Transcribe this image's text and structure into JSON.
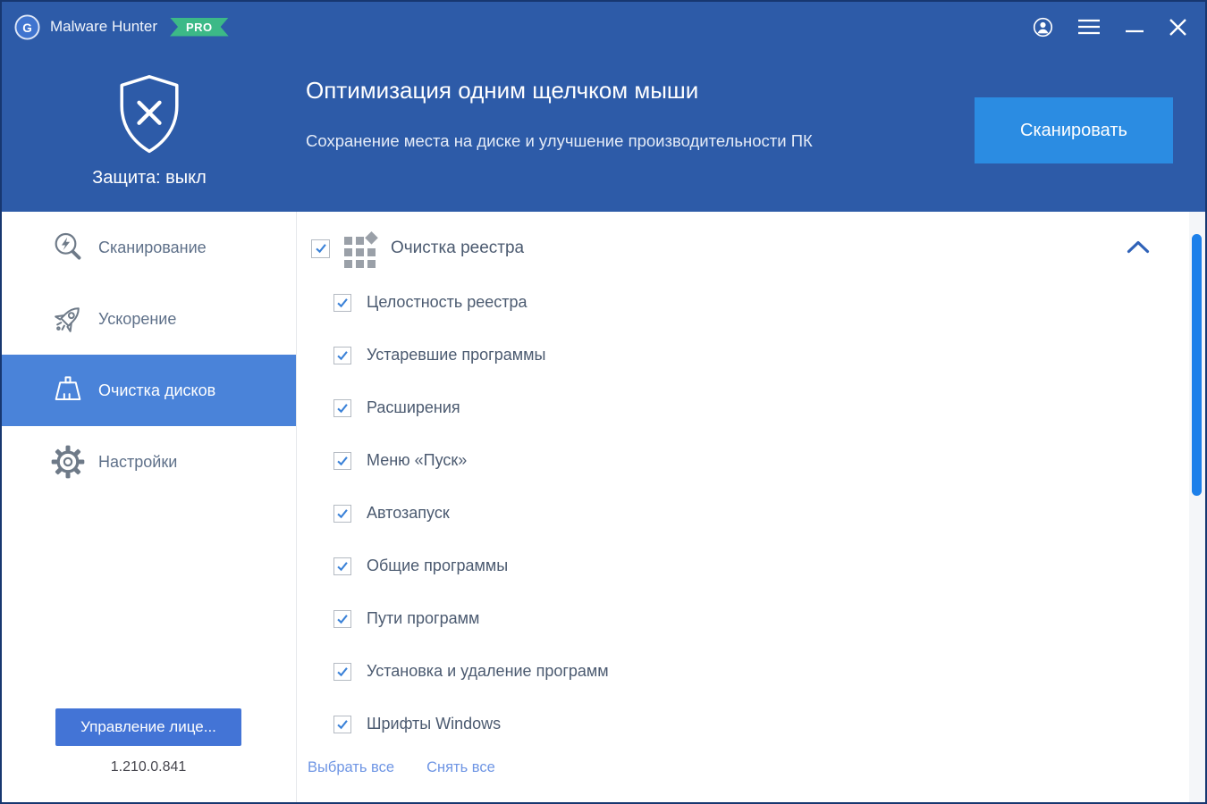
{
  "titlebar": {
    "app_name": "Malware Hunter",
    "badge": "PRO"
  },
  "header": {
    "protection_status": "Защита: выкл",
    "title": "Оптимизация одним щелчком мыши",
    "subtitle": "Сохранение места на диске и улучшение производительности ПК",
    "scan_button": "Сканировать"
  },
  "sidebar": {
    "items": [
      {
        "label": "Сканирование",
        "icon": "magnifier-lightning-icon",
        "selected": false
      },
      {
        "label": "Ускорение",
        "icon": "rocket-icon",
        "selected": false
      },
      {
        "label": "Очистка дисков",
        "icon": "broom-icon",
        "selected": true
      },
      {
        "label": "Настройки",
        "icon": "gear-icon",
        "selected": false
      }
    ],
    "license_button": "Управление лице...",
    "version": "1.210.0.841"
  },
  "main": {
    "group": {
      "label": "Очистка реестра",
      "checked": true,
      "expanded": true
    },
    "items": [
      {
        "label": "Целостность реестра",
        "checked": true
      },
      {
        "label": "Устаревшие программы",
        "checked": true
      },
      {
        "label": "Расширения",
        "checked": true
      },
      {
        "label": "Меню «Пуск»",
        "checked": true
      },
      {
        "label": "Автозапуск",
        "checked": true
      },
      {
        "label": "Общие программы",
        "checked": true
      },
      {
        "label": "Пути программ",
        "checked": true
      },
      {
        "label": "Установка и удаление программ",
        "checked": true
      },
      {
        "label": "Шрифты Windows",
        "checked": true
      }
    ],
    "select_all": "Выбрать все",
    "deselect_all": "Снять все"
  },
  "colors": {
    "titlebar_blue": "#2d5ba8",
    "scan_button_blue": "#2b8ce2",
    "selected_item_blue": "#4a83d9",
    "pro_badge_green": "#3cb987",
    "scrollbar_thumb_blue": "#1d80ea",
    "link_blue": "#6e95e4",
    "checkmark_blue": "#3b82d8"
  }
}
